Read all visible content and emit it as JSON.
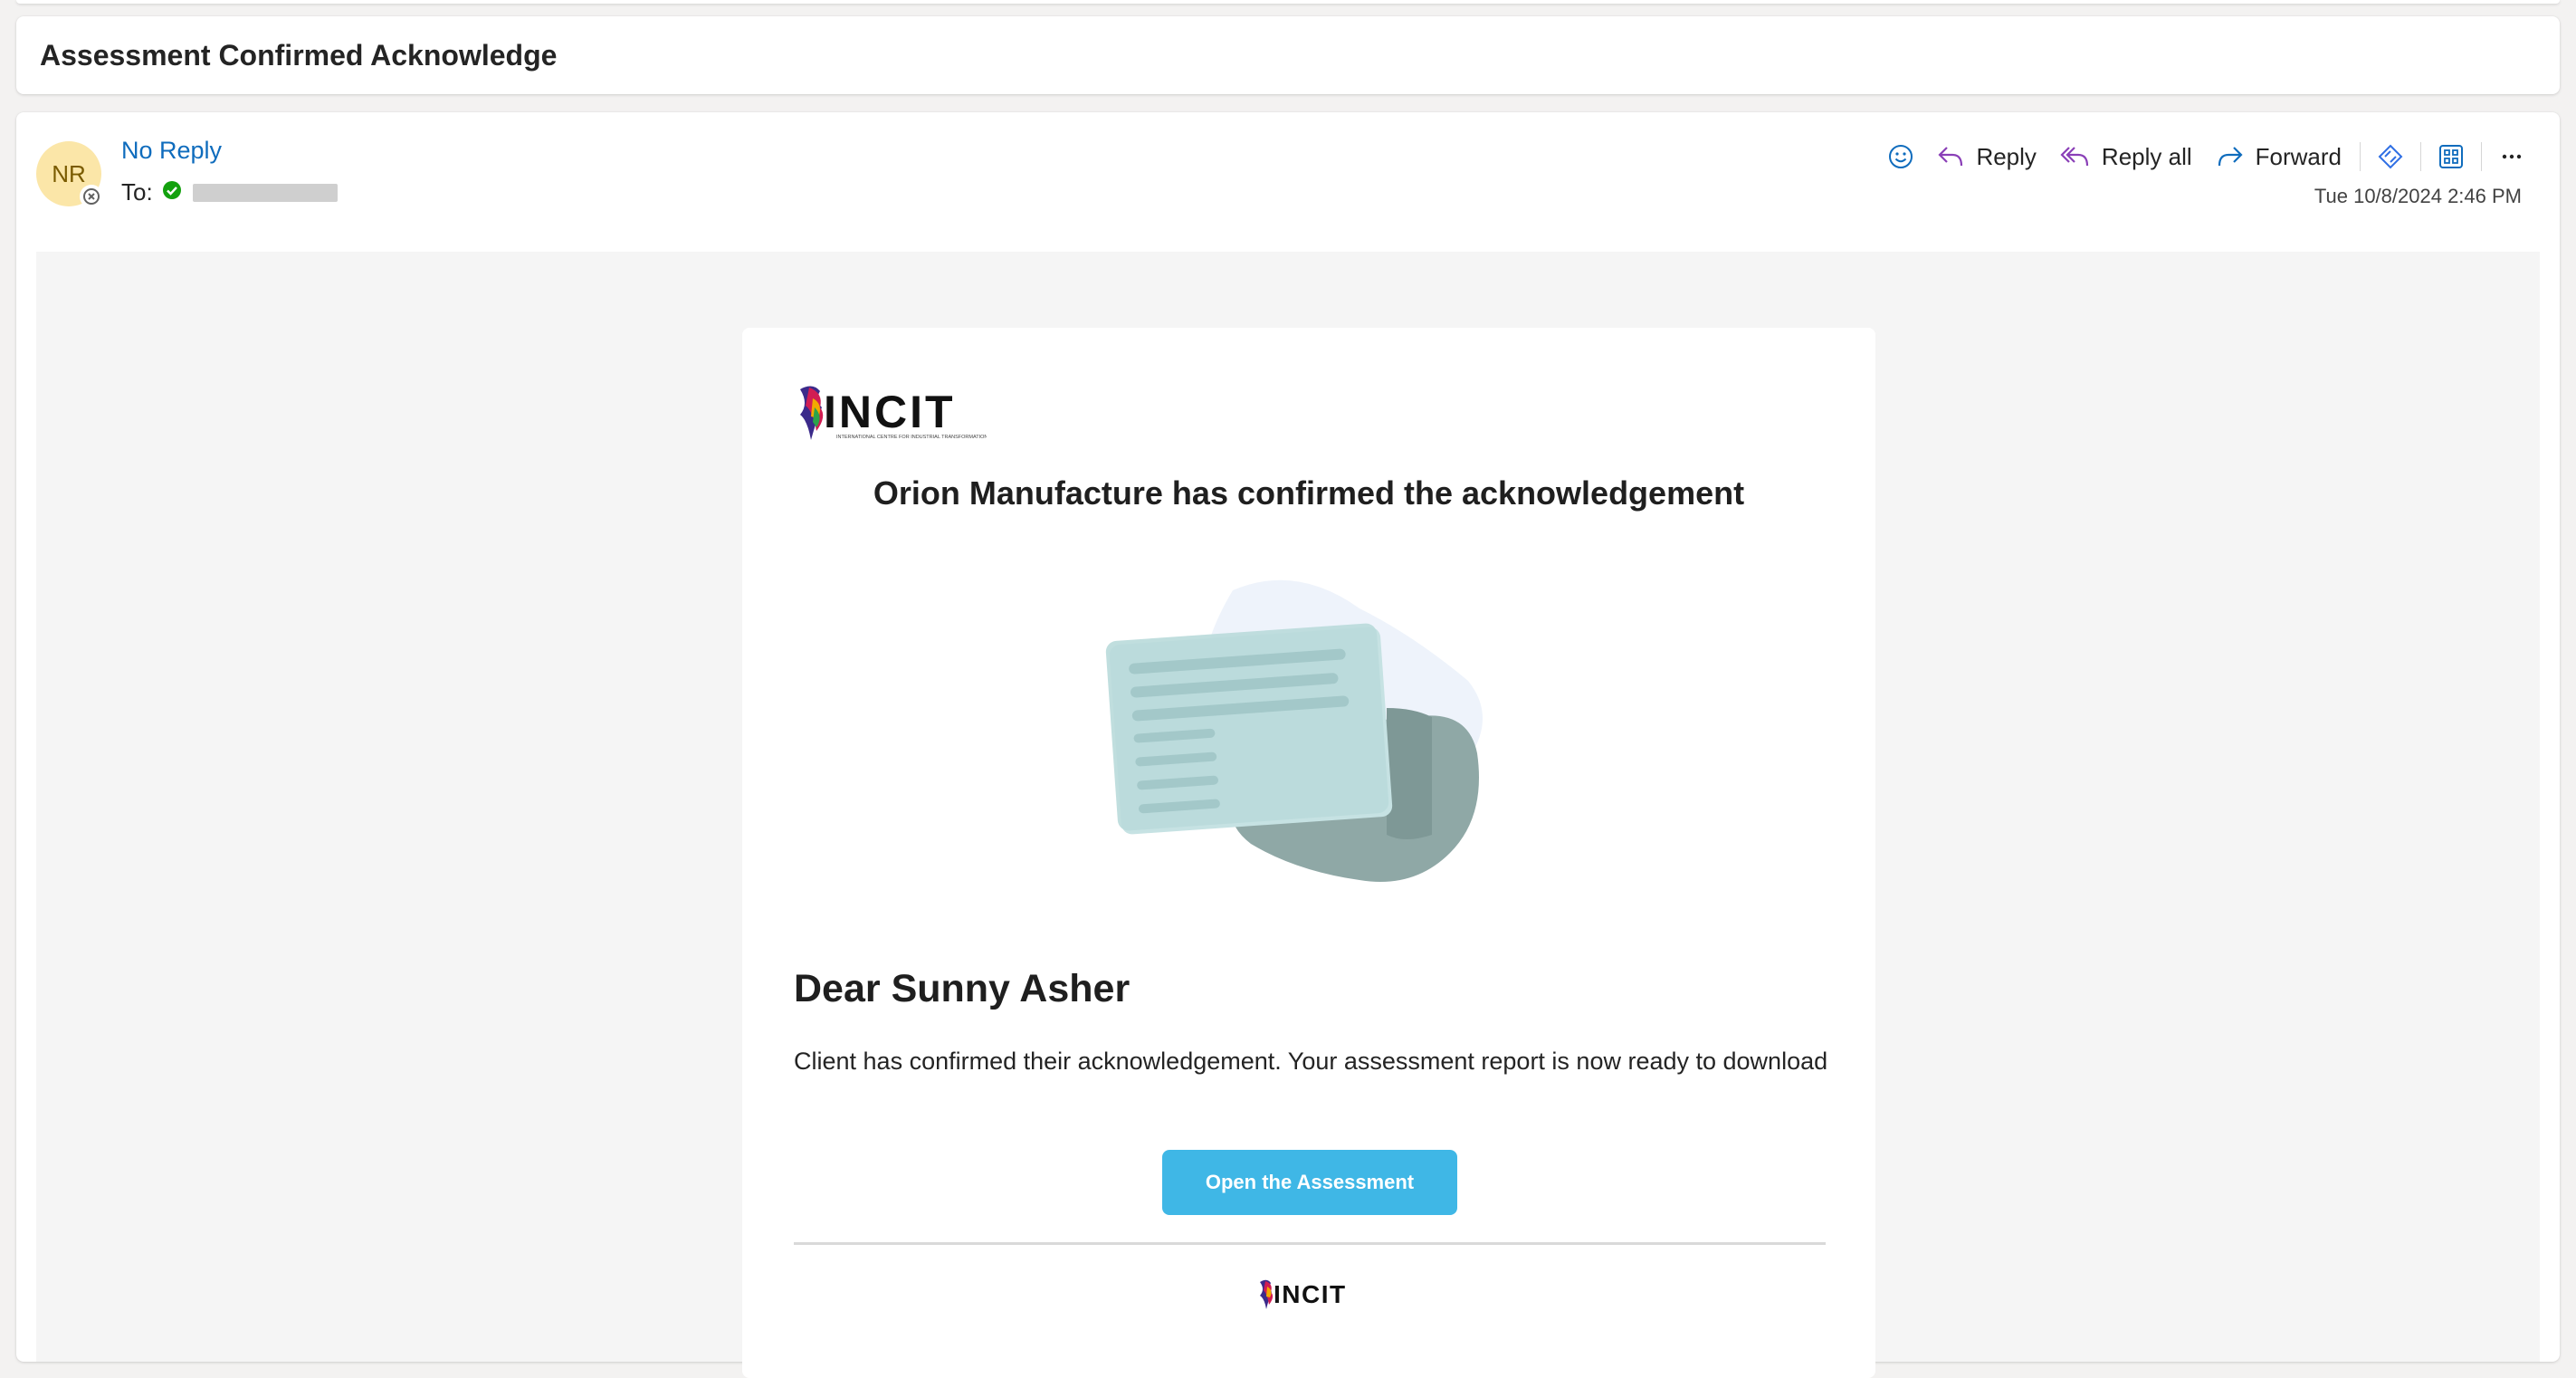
{
  "mail": {
    "subject": "Assessment Confirmed Acknowledge",
    "sender": {
      "initials": "NR",
      "name": "No Reply",
      "to_label": "To:"
    },
    "actions": {
      "reply": "Reply",
      "reply_all": "Reply all",
      "forward": "Forward"
    },
    "timestamp": "Tue 10/8/2024 2:46 PM"
  },
  "email_body": {
    "logo_text": "INCIT",
    "logo_tagline": "INTERNATIONAL CENTRE FOR INDUSTRIAL TRANSFORMATION",
    "headline": "Orion Manufacture has confirmed the acknowledgement",
    "greeting": "Dear Sunny Asher",
    "message": "Client has confirmed their acknowledgement. Your assessment report is now ready to download",
    "cta_label": "Open the Assessment",
    "accent_color": "#3fb7e6"
  },
  "colors": {
    "link": "#0f6cbd",
    "avatar_bg": "#fbe6a8",
    "body_bg": "#f5f5f5"
  }
}
